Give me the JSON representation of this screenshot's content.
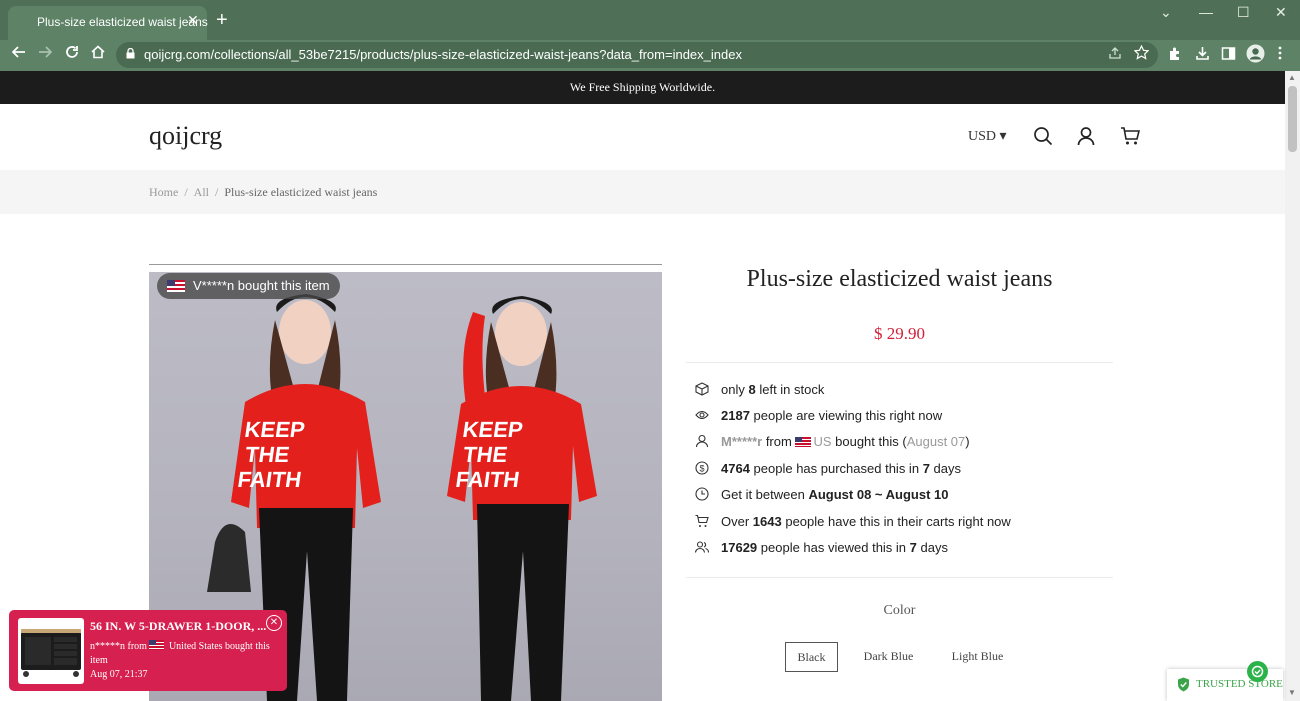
{
  "browser": {
    "tab_title": "Plus-size elasticized waist jeans",
    "tab_close": "✕",
    "new_tab": "+",
    "url": "qoijcrg.com/collections/all_53be7215/products/plus-size-elasticized-waist-jeans?data_from=index_index",
    "controls": {
      "minimize": "—",
      "maximize": "☐",
      "close": "✕",
      "dropdown": "⌄"
    }
  },
  "announcement": "We Free Shipping Worldwide.",
  "header": {
    "logo": "qoijcrg",
    "currency": "USD ▾",
    "icons": [
      "search-icon",
      "account-icon",
      "cart-icon"
    ]
  },
  "breadcrumb": {
    "home": "Home",
    "all": "All",
    "separator": "/",
    "current": "Plus-size elasticized waist jeans"
  },
  "gallery": {
    "bought_badge": "V*****n bought this item"
  },
  "product": {
    "title": "Plus-size elasticized waist jeans",
    "price": "$ 29.90",
    "stock": {
      "pre": "only",
      "count": "8",
      "post": "left in stock"
    },
    "viewing": {
      "count": "2187",
      "post": "people are viewing this right now"
    },
    "recent_buyer": {
      "name": "M*****r",
      "from": "from",
      "country": "US",
      "bought": "bought this",
      "date_open": "(",
      "date": "August 07",
      "date_close": ")"
    },
    "purchased": {
      "count": "4764",
      "mid": "people has purchased this in",
      "days": "7",
      "post": "days"
    },
    "delivery": {
      "pre": "Get it between",
      "range": "August 08 ~ August 10"
    },
    "carts": {
      "pre": "Over",
      "count": "1643",
      "post": "people have this in their carts right now"
    },
    "viewed": {
      "count": "17629",
      "mid": "people has viewed this in",
      "days": "7",
      "post": "days"
    },
    "color_label": "Color",
    "colors": [
      "Black",
      "Dark Blue",
      "Light Blue"
    ],
    "selected_color": "Black"
  },
  "notification": {
    "title": "56 IN. W 5-DRAWER 1-DOOR, ...",
    "buyer": "n*****n from",
    "location": "United States bought this",
    "line2": "item",
    "time": "Aug 07, 21:37",
    "close": "✕"
  },
  "trust_badge": "TRUSTED STORE",
  "colors": {
    "accent_price": "#d0213a",
    "chrome": "#5d8266",
    "popup": "#d6204f",
    "trusted": "#3ba44a"
  }
}
